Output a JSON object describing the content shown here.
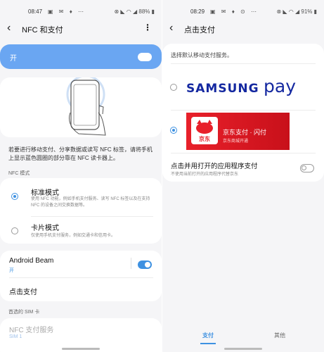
{
  "left": {
    "status": {
      "time": "08:47",
      "notifications": "▣ ✉ ♦ ⋯",
      "system": "⊗ ◣ ◠ ◢ 88% ▮"
    },
    "title": "NFC 和支付",
    "master_switch": {
      "label": "开",
      "state": "on"
    },
    "description": "若要进行移动支付、分享数据或读写 NFC 标签，请将手机上显示蓝色圆圈的部分靠在 NFC 读卡器上。",
    "nfc_mode": {
      "section_label": "NFC 模式",
      "options": [
        {
          "title": "标准模式",
          "desc": "使用 NFC 功能，例如手机支付服务、读写 NFC 标签以及在支持 NFC 的设备之间交换数据等。",
          "selected": true
        },
        {
          "title": "卡片模式",
          "desc": "仅使用手机支付服务，例如交通卡和信用卡。",
          "selected": false
        }
      ]
    },
    "android_beam": {
      "title": "Android Beam",
      "status": "开",
      "state": "on"
    },
    "tap_pay": {
      "title": "点击支付"
    },
    "sim": {
      "section_label": "首选的 SIM 卡",
      "title": "NFC 支付服务",
      "value": "SIM 1"
    }
  },
  "right": {
    "status": {
      "time": "08:29",
      "notifications": "▣ ✉ ♦ ⊙ ⋯",
      "system": "⊗ ◣ ◠ ◢ 91% ▮"
    },
    "title": "点击支付",
    "instruction": "选择默认移动支付服务。",
    "options": [
      {
        "name": "Samsung Pay",
        "logo_left": "SAMSUNG",
        "logo_right": "pay",
        "selected": false
      },
      {
        "name": "京东支付 · 闪付",
        "sub": "京东商城开通",
        "brand_mark": "京东",
        "selected": true
      }
    ],
    "open_app": {
      "title": "点击并用打开的应用程序支付",
      "desc": "不使用当前打开的应用程序代替京东",
      "state": "off"
    },
    "tabs": [
      {
        "label": "支付",
        "active": true
      },
      {
        "label": "其他",
        "active": false
      }
    ]
  },
  "colors": {
    "accent": "#3e91e1",
    "master_bg": "#6aa6f2",
    "jd_red": "#d61621",
    "samsung_blue": "#1428a0"
  }
}
